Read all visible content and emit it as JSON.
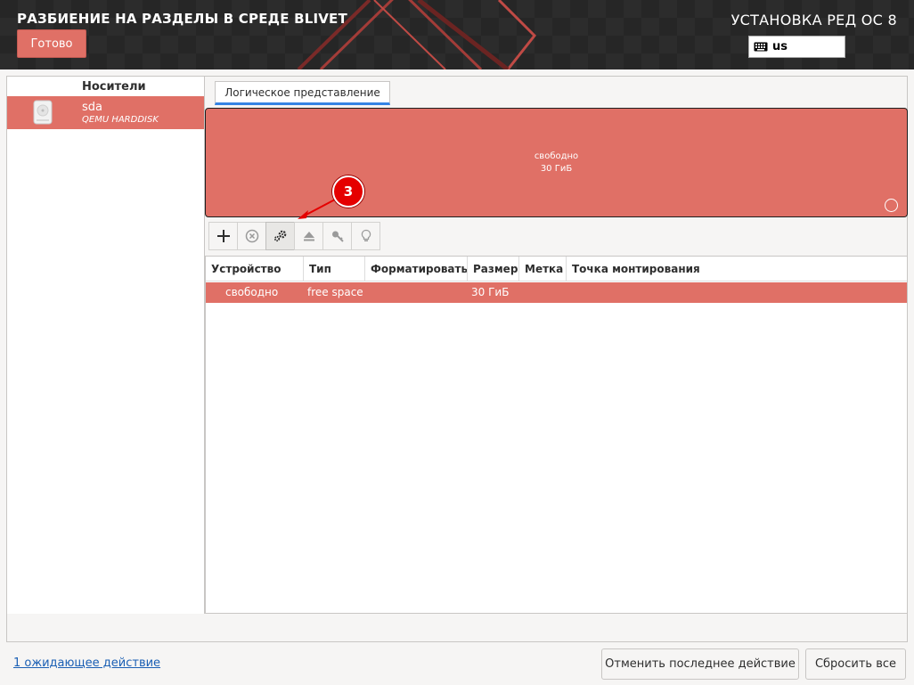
{
  "header": {
    "title": "РАЗБИЕНИЕ НА РАЗДЕЛЫ В СРЕДЕ BLIVET",
    "done_label": "Готово",
    "product": "УСТАНОВКА РЕД ОС 8",
    "keyboard_layout": "us"
  },
  "devices": {
    "header": "Носители",
    "items": [
      {
        "name": "sda",
        "model": "QEMU HARDDISK"
      }
    ]
  },
  "tabs": [
    {
      "label": "Логическое представление",
      "selected": true
    }
  ],
  "visualization": {
    "label": "свободно",
    "size": "30 ГиБ"
  },
  "toolbar": {
    "icons": [
      "add-icon",
      "delete-icon",
      "settings-gear-icon",
      "eject-icon",
      "key-icon",
      "lightbulb-icon"
    ]
  },
  "table": {
    "columns": [
      "Устройство",
      "Тип",
      "Форматировать",
      "Размер",
      "Метка",
      "Точка монтирования"
    ],
    "rows": [
      {
        "device": "свободно",
        "type": "free space",
        "format": "",
        "size": "30 ГиБ",
        "label": "",
        "mount": ""
      }
    ]
  },
  "annotation": {
    "number": "3"
  },
  "footer": {
    "pending_link": "1 ожидающее действие",
    "undo_label": "Отменить последнее действие",
    "reset_label": "Сбросить все"
  },
  "colors": {
    "accent": "#e07066",
    "header_bg": "#262626",
    "tab_underline": "#3584e4",
    "annotation": "#e50000"
  }
}
